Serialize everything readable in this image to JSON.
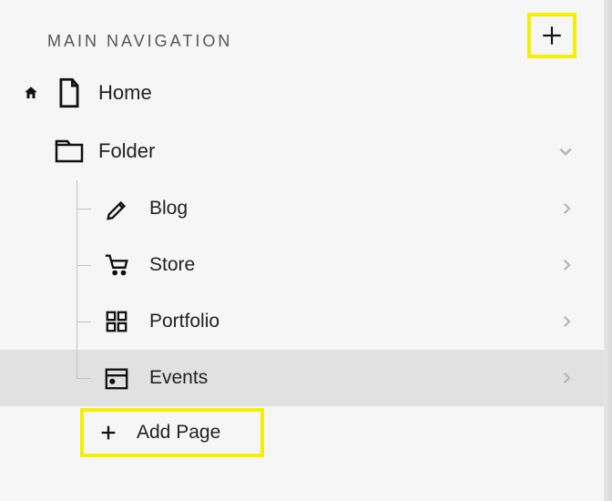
{
  "header": {
    "title": "MAIN NAVIGATION"
  },
  "items": {
    "home": "Home",
    "folder": "Folder",
    "children": {
      "blog": "Blog",
      "store": "Store",
      "portfolio": "Portfolio",
      "events": "Events"
    },
    "addPage": "Add Page"
  },
  "colors": {
    "highlight": "#f4f000"
  }
}
